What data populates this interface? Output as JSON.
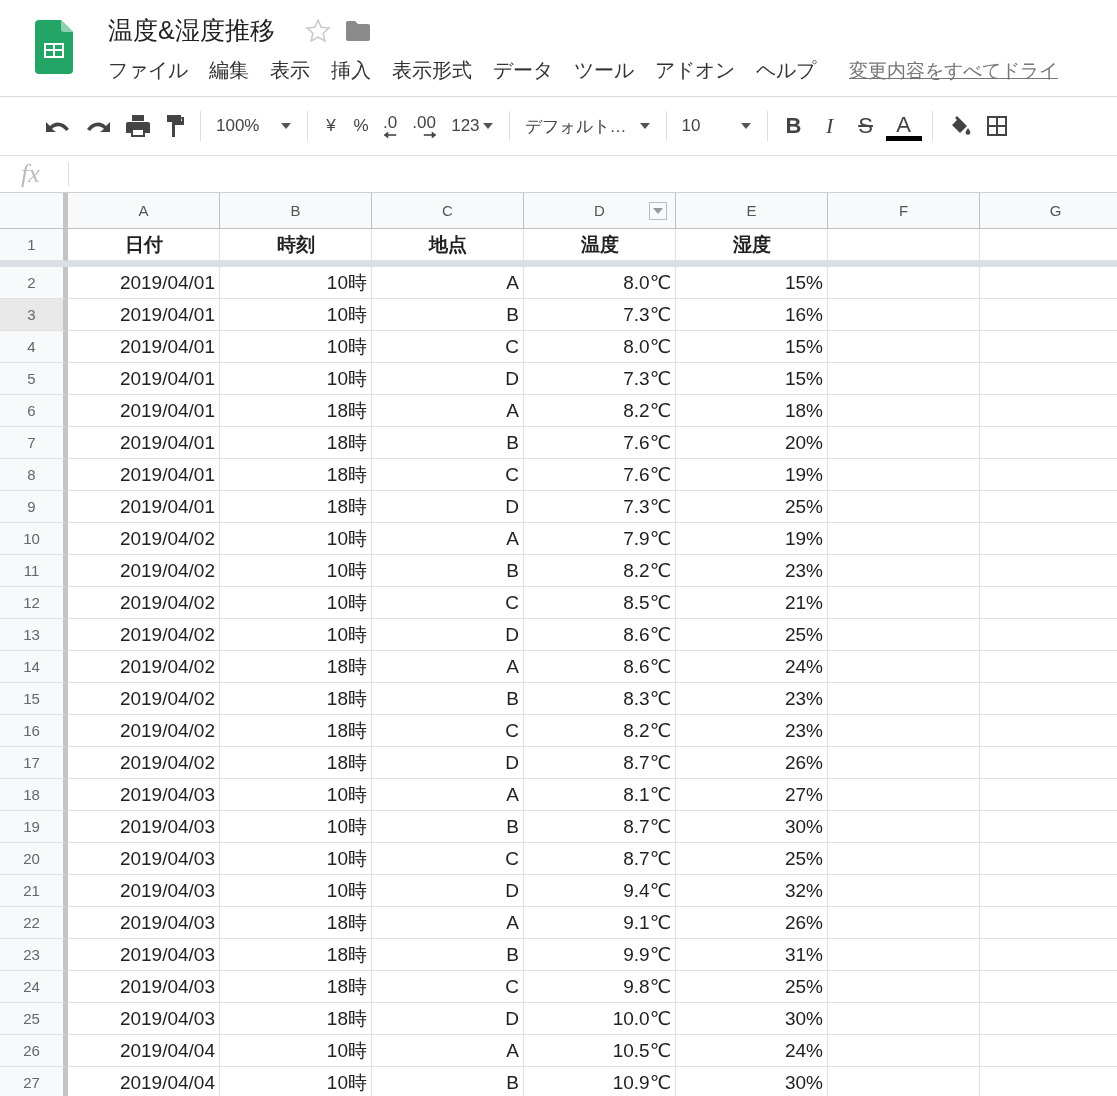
{
  "document": {
    "title": "温度&湿度推移"
  },
  "menu": [
    "ファイル",
    "編集",
    "表示",
    "挿入",
    "表示形式",
    "データ",
    "ツール",
    "アドオン",
    "ヘルプ"
  ],
  "save_status": "変更内容をすべてドライ",
  "toolbar": {
    "zoom": "100%",
    "currency": "¥",
    "percent": "%",
    "decrease_decimals": ".0",
    "increase_decimals": ".00",
    "number_format": "123",
    "font": "デフォルト…",
    "font_size": "10",
    "bold": "B",
    "italic": "I",
    "strikethrough": "S",
    "text_color": "A"
  },
  "formula_bar": {
    "label": "fx"
  },
  "columns": [
    {
      "label": "A",
      "filter": false
    },
    {
      "label": "B",
      "filter": false
    },
    {
      "label": "C",
      "filter": false
    },
    {
      "label": "D",
      "filter": true
    },
    {
      "label": "E",
      "filter": false
    },
    {
      "label": "F",
      "filter": false
    },
    {
      "label": "G",
      "filter": false
    }
  ],
  "header_row": {
    "number": "1",
    "cells": [
      "日付",
      "時刻",
      "地点",
      "温度",
      "湿度"
    ]
  },
  "rows": [
    {
      "number": "2",
      "hovered": false,
      "cells": [
        "2019/04/01",
        "10時",
        "A",
        "8.0℃",
        "15%"
      ]
    },
    {
      "number": "3",
      "hovered": true,
      "cells": [
        "2019/04/01",
        "10時",
        "B",
        "7.3℃",
        "16%"
      ]
    },
    {
      "number": "4",
      "hovered": false,
      "cells": [
        "2019/04/01",
        "10時",
        "C",
        "8.0℃",
        "15%"
      ]
    },
    {
      "number": "5",
      "hovered": false,
      "cells": [
        "2019/04/01",
        "10時",
        "D",
        "7.3℃",
        "15%"
      ]
    },
    {
      "number": "6",
      "hovered": false,
      "cells": [
        "2019/04/01",
        "18時",
        "A",
        "8.2℃",
        "18%"
      ]
    },
    {
      "number": "7",
      "hovered": false,
      "cells": [
        "2019/04/01",
        "18時",
        "B",
        "7.6℃",
        "20%"
      ]
    },
    {
      "number": "8",
      "hovered": false,
      "cells": [
        "2019/04/01",
        "18時",
        "C",
        "7.6℃",
        "19%"
      ]
    },
    {
      "number": "9",
      "hovered": false,
      "cells": [
        "2019/04/01",
        "18時",
        "D",
        "7.3℃",
        "25%"
      ]
    },
    {
      "number": "10",
      "hovered": false,
      "cells": [
        "2019/04/02",
        "10時",
        "A",
        "7.9℃",
        "19%"
      ]
    },
    {
      "number": "11",
      "hovered": false,
      "cells": [
        "2019/04/02",
        "10時",
        "B",
        "8.2℃",
        "23%"
      ]
    },
    {
      "number": "12",
      "hovered": false,
      "cells": [
        "2019/04/02",
        "10時",
        "C",
        "8.5℃",
        "21%"
      ]
    },
    {
      "number": "13",
      "hovered": false,
      "cells": [
        "2019/04/02",
        "10時",
        "D",
        "8.6℃",
        "25%"
      ]
    },
    {
      "number": "14",
      "hovered": false,
      "cells": [
        "2019/04/02",
        "18時",
        "A",
        "8.6℃",
        "24%"
      ]
    },
    {
      "number": "15",
      "hovered": false,
      "cells": [
        "2019/04/02",
        "18時",
        "B",
        "8.3℃",
        "23%"
      ]
    },
    {
      "number": "16",
      "hovered": false,
      "cells": [
        "2019/04/02",
        "18時",
        "C",
        "8.2℃",
        "23%"
      ]
    },
    {
      "number": "17",
      "hovered": false,
      "cells": [
        "2019/04/02",
        "18時",
        "D",
        "8.7℃",
        "26%"
      ]
    },
    {
      "number": "18",
      "hovered": false,
      "cells": [
        "2019/04/03",
        "10時",
        "A",
        "8.1℃",
        "27%"
      ]
    },
    {
      "number": "19",
      "hovered": false,
      "cells": [
        "2019/04/03",
        "10時",
        "B",
        "8.7℃",
        "30%"
      ]
    },
    {
      "number": "20",
      "hovered": false,
      "cells": [
        "2019/04/03",
        "10時",
        "C",
        "8.7℃",
        "25%"
      ]
    },
    {
      "number": "21",
      "hovered": false,
      "cells": [
        "2019/04/03",
        "10時",
        "D",
        "9.4℃",
        "32%"
      ]
    },
    {
      "number": "22",
      "hovered": false,
      "cells": [
        "2019/04/03",
        "18時",
        "A",
        "9.1℃",
        "26%"
      ]
    },
    {
      "number": "23",
      "hovered": false,
      "cells": [
        "2019/04/03",
        "18時",
        "B",
        "9.9℃",
        "31%"
      ]
    },
    {
      "number": "24",
      "hovered": false,
      "cells": [
        "2019/04/03",
        "18時",
        "C",
        "9.8℃",
        "25%"
      ]
    },
    {
      "number": "25",
      "hovered": false,
      "cells": [
        "2019/04/03",
        "18時",
        "D",
        "10.0℃",
        "30%"
      ]
    },
    {
      "number": "26",
      "hovered": false,
      "cells": [
        "2019/04/04",
        "10時",
        "A",
        "10.5℃",
        "24%"
      ]
    },
    {
      "number": "27",
      "hovered": false,
      "cells": [
        "2019/04/04",
        "10時",
        "B",
        "10.9℃",
        "30%"
      ]
    }
  ]
}
